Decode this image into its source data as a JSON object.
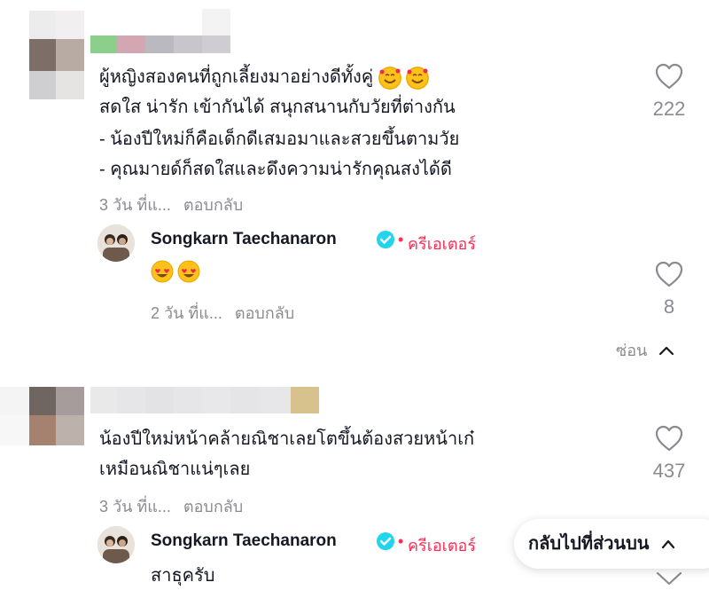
{
  "comments": [
    {
      "lines": [
        "ผู้หญิงสองคนที่ถูกเลี้ยงมาอย่างดีทั้งคู่",
        "สดใส น่ารัก เข้ากันได้ สนุกสนานกับวัยที่ต่างกัน",
        "- น้องปีใหม่ก็คือเด็กดีเสมอมาและสวยขึ้นตามวัย",
        "- คุณมายด์ก็สดใสและดึงความน่ารักคุณสงได้ดี"
      ],
      "time": "3 วัน ที่แ...",
      "reply_label": "ตอบกลับ",
      "likes": "222",
      "reply": {
        "author": "Songkarn Taechanaron",
        "badge": "ครีเอเตอร์",
        "text": "",
        "time": "2 วัน ที่แ...",
        "reply_label": "ตอบกลับ",
        "likes": "8"
      },
      "hide_label": "ซ่อน"
    },
    {
      "lines": [
        "น้องปีใหม่หน้าคล้ายณิชาเลยโตขึ้นต้องสวยหน้าเก๋",
        "เหมือนณิชาแน่ๆเลย"
      ],
      "time": "3 วัน ที่แ...",
      "reply_label": "ตอบกลับ",
      "likes": "437",
      "reply": {
        "author": "Songkarn Taechanaron",
        "badge": "ครีเอเตอร์",
        "text": "สาธุครับ"
      }
    }
  ],
  "back_to_top": "กลับไปที่ส่วนบน",
  "colors": {
    "creator": "#fe2c55",
    "verified": "#20d5ec",
    "muted": "#8a8b91"
  }
}
